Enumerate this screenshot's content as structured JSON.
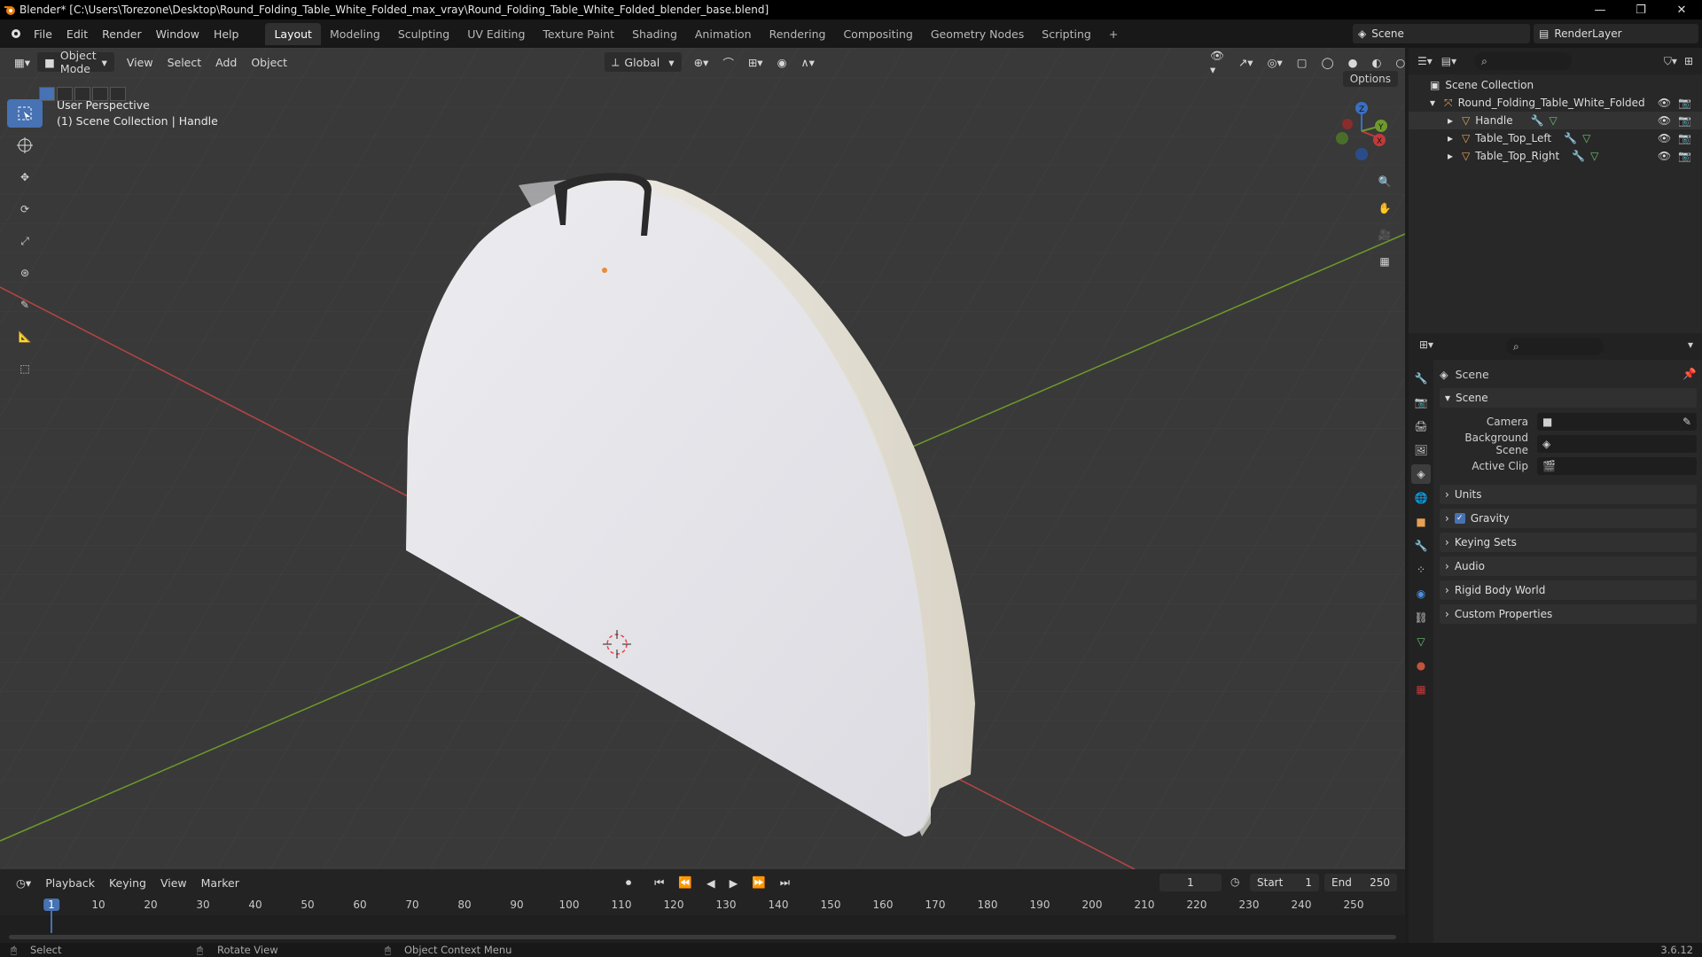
{
  "window": {
    "title": "Blender* [C:\\Users\\Torezone\\Desktop\\Round_Folding_Table_White_Folded_max_vray\\Round_Folding_Table_White_Folded_blender_base.blend]"
  },
  "menu": [
    "File",
    "Edit",
    "Render",
    "Window",
    "Help"
  ],
  "workspaces": [
    "Layout",
    "Modeling",
    "Sculpting",
    "UV Editing",
    "Texture Paint",
    "Shading",
    "Animation",
    "Rendering",
    "Compositing",
    "Geometry Nodes",
    "Scripting"
  ],
  "scene_name": "Scene",
  "view_layer": "RenderLayer",
  "viewport": {
    "mode": "Object Mode",
    "menus": [
      "View",
      "Select",
      "Add",
      "Object"
    ],
    "transform": "Global",
    "options": "Options",
    "perspective": "User Perspective",
    "collection_info": "(1) Scene Collection | Handle"
  },
  "outliner": {
    "root": "Scene Collection",
    "collection": "Round_Folding_Table_White_Folded",
    "objects": [
      "Handle",
      "Table_Top_Left",
      "Table_Top_Right"
    ]
  },
  "properties": {
    "header": "Scene",
    "panel": "Scene",
    "fields": [
      {
        "label": "Camera"
      },
      {
        "label": "Background Scene"
      },
      {
        "label": "Active Clip"
      }
    ],
    "sections": [
      "Units",
      "Gravity",
      "Keying Sets",
      "Audio",
      "Rigid Body World",
      "Custom Properties"
    ]
  },
  "timeline": {
    "menus": [
      "Playback",
      "Keying",
      "View",
      "Marker"
    ],
    "current_frame": "1",
    "start_label": "Start",
    "start": "1",
    "end_label": "End",
    "end": "250",
    "ticks": [
      "1",
      "10",
      "20",
      "30",
      "40",
      "50",
      "60",
      "70",
      "80",
      "90",
      "100",
      "110",
      "120",
      "130",
      "140",
      "150",
      "160",
      "170",
      "180",
      "190",
      "200",
      "210",
      "220",
      "230",
      "240",
      "250"
    ]
  },
  "status": {
    "select": "Select",
    "rotate": "Rotate View",
    "context": "Object Context Menu",
    "version": "3.6.12"
  },
  "colors": {
    "accent": "#4772b3",
    "x_axis": "#c23a3a",
    "y_axis": "#6e9a2a",
    "z_axis": "#3a6fc2"
  }
}
